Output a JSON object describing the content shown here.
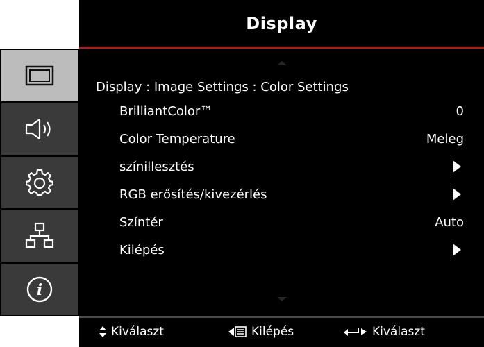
{
  "header": {
    "title": "Display"
  },
  "sidebar": {
    "items": [
      {
        "icon": "display-icon",
        "active": true
      },
      {
        "icon": "speaker-icon",
        "active": false
      },
      {
        "icon": "gear-icon",
        "active": false
      },
      {
        "icon": "network-icon",
        "active": false
      },
      {
        "icon": "info-icon",
        "active": false
      }
    ]
  },
  "breadcrumb": "Display : Image Settings : Color Settings",
  "menu": {
    "items": [
      {
        "label": "BrilliantColor™",
        "value": "0"
      },
      {
        "label": "Color Temperature",
        "value": "Meleg"
      },
      {
        "label": "színillesztés",
        "value": "",
        "submenu": true
      },
      {
        "label": "RGB erősítés/kivezérlés",
        "value": "",
        "submenu": true
      },
      {
        "label": "Színtér",
        "value": "Auto"
      },
      {
        "label": "Kilépés",
        "value": "",
        "submenu": true
      }
    ]
  },
  "footer": {
    "select_label": "Kiválaszt",
    "exit_label": "Kilépés",
    "enter_label": "Kiválaszt"
  }
}
